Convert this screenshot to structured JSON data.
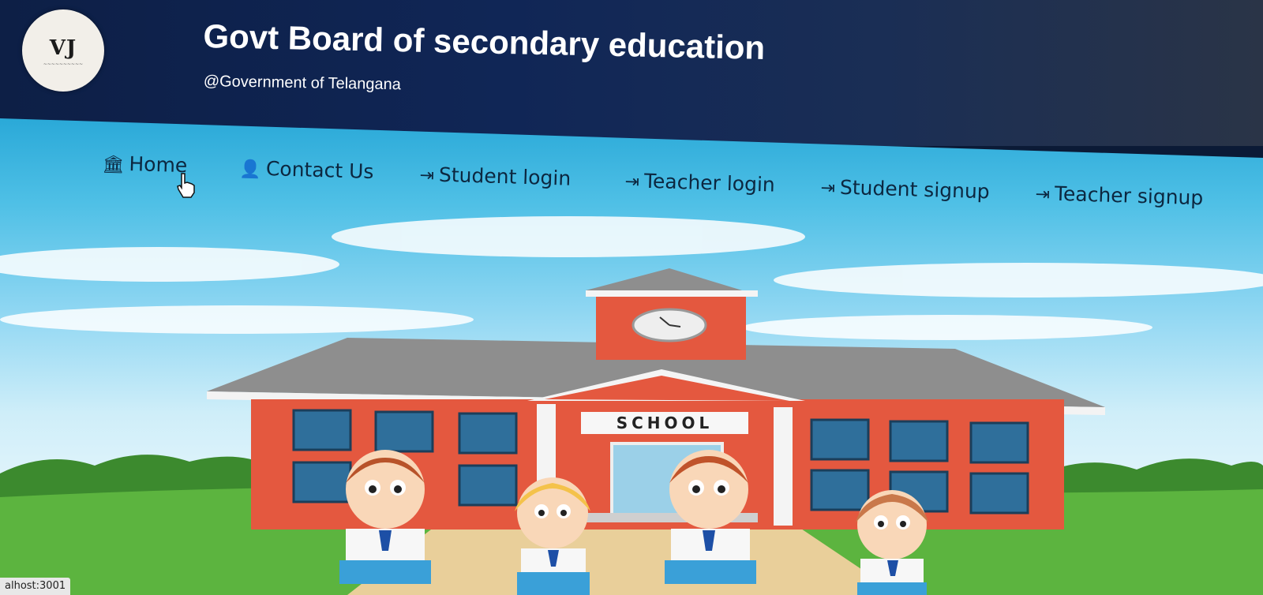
{
  "header": {
    "logo_text": "VJ",
    "title": "Govt Board of secondary education",
    "subtitle": "@Government of Telangana"
  },
  "nav": {
    "items": [
      {
        "label": "Home",
        "icon": "bank-icon",
        "glyph": "🏛"
      },
      {
        "label": "Contact Us",
        "icon": "user-circle-icon",
        "glyph": "👤"
      },
      {
        "label": "Student login",
        "icon": "login-icon",
        "glyph": "⇥"
      },
      {
        "label": "Teacher login",
        "icon": "login-icon",
        "glyph": "⇥"
      },
      {
        "label": "Student signup",
        "icon": "login-icon",
        "glyph": "⇥"
      },
      {
        "label": "Teacher signup",
        "icon": "login-icon",
        "glyph": "⇥"
      }
    ]
  },
  "hero": {
    "sign_text": "SCHOOL"
  },
  "status_bar": {
    "url": "alhost:3001"
  },
  "colors": {
    "header_bg": "#102656",
    "sky": "#4fc0e6",
    "building": "#e4583f",
    "roof": "#8a8a8a",
    "grass": "#4fa83a"
  }
}
